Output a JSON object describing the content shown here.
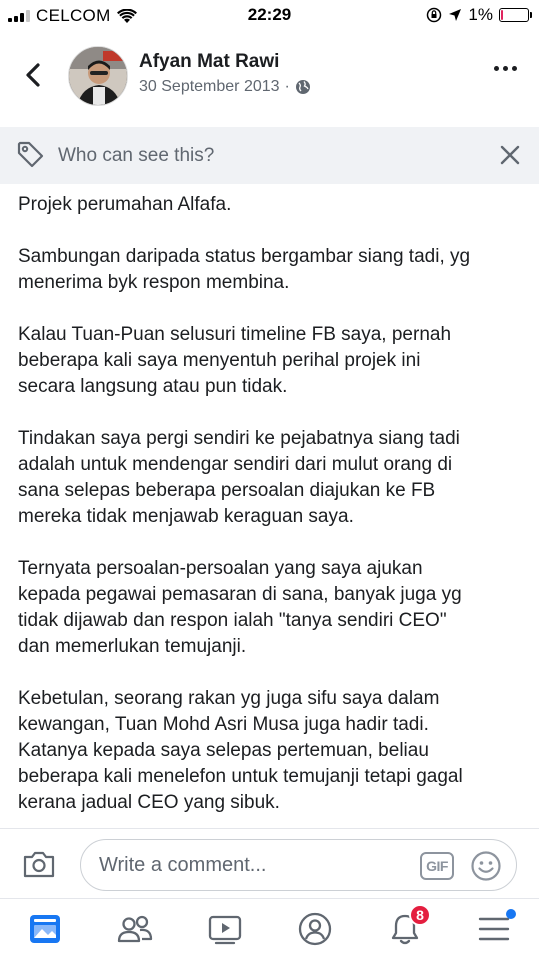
{
  "status_bar": {
    "carrier": "CELCOM",
    "time": "22:29",
    "battery": "1%",
    "battery_level": 0.01
  },
  "post_header": {
    "author_name": "Afyan Mat Rawi",
    "date": "30 September 2013",
    "separator": "·",
    "audience_icon": "globe-icon"
  },
  "privacy": {
    "label": "Who can see this?"
  },
  "post": {
    "paragraphs": [
      "Projek perumahan Alfafa.",
      "Sambungan daripada status bergambar siang tadi, yg\nmenerima byk respon membina.",
      "Kalau Tuan-Puan selusuri timeline FB saya, pernah\nbeberapa kali saya menyentuh perihal projek ini\nsecara langsung atau pun tidak.",
      "Tindakan saya pergi sendiri ke pejabatnya siang tadi\nadalah untuk mendengar sendiri dari mulut  orang di\nsana selepas beberapa persoalan diajukan ke FB\nmereka tidak menjawab keraguan saya.",
      "Ternyata persoalan-persoalan yang saya ajukan\nkepada pegawai pemasaran di sana, banyak juga yg\ntidak dijawab dan respon ialah \"tanya sendiri CEO\"\ndan memerlukan temujanji.",
      "Kebetulan, seorang rakan yg juga sifu saya dalam\nkewangan, Tuan Mohd Asri Musa juga hadir tadi.\nKatanya kepada saya selepas pertemuan, beliau\nbeberapa kali menelefon untuk temujanji tetapi gagal\nkerana jadual CEO yang sibuk."
    ]
  },
  "comment_bar": {
    "placeholder": "Write a comment...",
    "gif_label": "GIF"
  },
  "bottom_nav": {
    "items": [
      {
        "icon": "news-feed-icon"
      },
      {
        "icon": "friends-icon"
      },
      {
        "icon": "watch-icon"
      },
      {
        "icon": "profile-icon"
      },
      {
        "icon": "bell-icon",
        "badge": "8"
      },
      {
        "icon": "menu-icon"
      }
    ]
  },
  "colors": {
    "brand": "#1877f2",
    "badge": "#e41e3f",
    "muted": "#606770",
    "privacy_bg": "#f0f2f5"
  }
}
